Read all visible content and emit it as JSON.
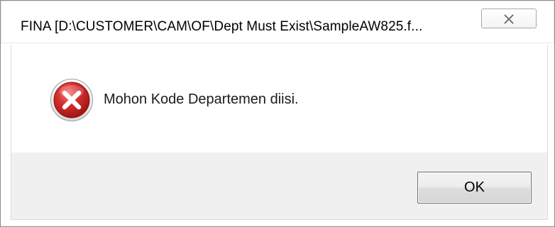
{
  "window": {
    "title": "FINA  [D:\\CUSTOMER\\CAM\\OF\\Dept Must Exist\\SampleAW825.f..."
  },
  "titlebar": {
    "close_icon": "close-icon"
  },
  "message": {
    "icon": "error-icon",
    "text": "Mohon Kode Departemen diisi."
  },
  "footer": {
    "ok_label": "OK"
  },
  "colors": {
    "error_red": "#c62828",
    "footer_bg": "#f0f0f0"
  }
}
